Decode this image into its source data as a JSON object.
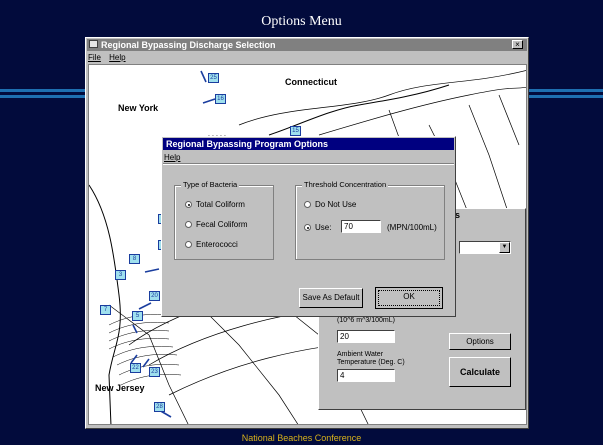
{
  "slide": {
    "title": "Options Menu",
    "footer": "National Beaches Conference"
  },
  "main_window": {
    "title": "Regional Bypassing Discharge Selection",
    "close_glyph": "×",
    "menu": {
      "file": "File",
      "help": "Help"
    }
  },
  "map": {
    "labels": {
      "connecticut": "Connecticut",
      "new_york": "New York",
      "new_jersey": "New Jersey"
    },
    "stations": [
      "25",
      "16",
      "15",
      "1",
      "1",
      "8",
      "3",
      "20",
      "7",
      "5",
      "22",
      "23",
      "28"
    ]
  },
  "calc_panel": {
    "title_fragment": "s",
    "dropdown_arrow": "▼",
    "rate_label": "(10^6 m^3/100mL)",
    "rate_value": "20",
    "options_button": "Options",
    "temp_label_1": "Ambient Water",
    "temp_label_2": "Temperature (Deg. C)",
    "temp_value": "4",
    "calculate_button": "Calculate"
  },
  "dialog": {
    "title": "Regional Bypassing Program Options",
    "menu_help": "Help",
    "bacteria": {
      "legend": "Type of Bacteria",
      "options": [
        "Total Coliform",
        "Fecal Coliform",
        "Enterococci"
      ],
      "selected": 0
    },
    "threshold": {
      "legend": "Threshold Concentration",
      "do_not_use": "Do Not Use",
      "use": "Use:",
      "value": "70",
      "unit": "(MPN/100mL)"
    },
    "save_default": "Save As Default",
    "ok": "OK"
  },
  "colors": {
    "background": "#020b3c",
    "band": "#1e6fb1",
    "footer": "#d8b21b",
    "active_title": "#000080",
    "inactive_title": "#808080",
    "station_fill": "#9fe0ee",
    "station_border": "#1a3d9e"
  }
}
